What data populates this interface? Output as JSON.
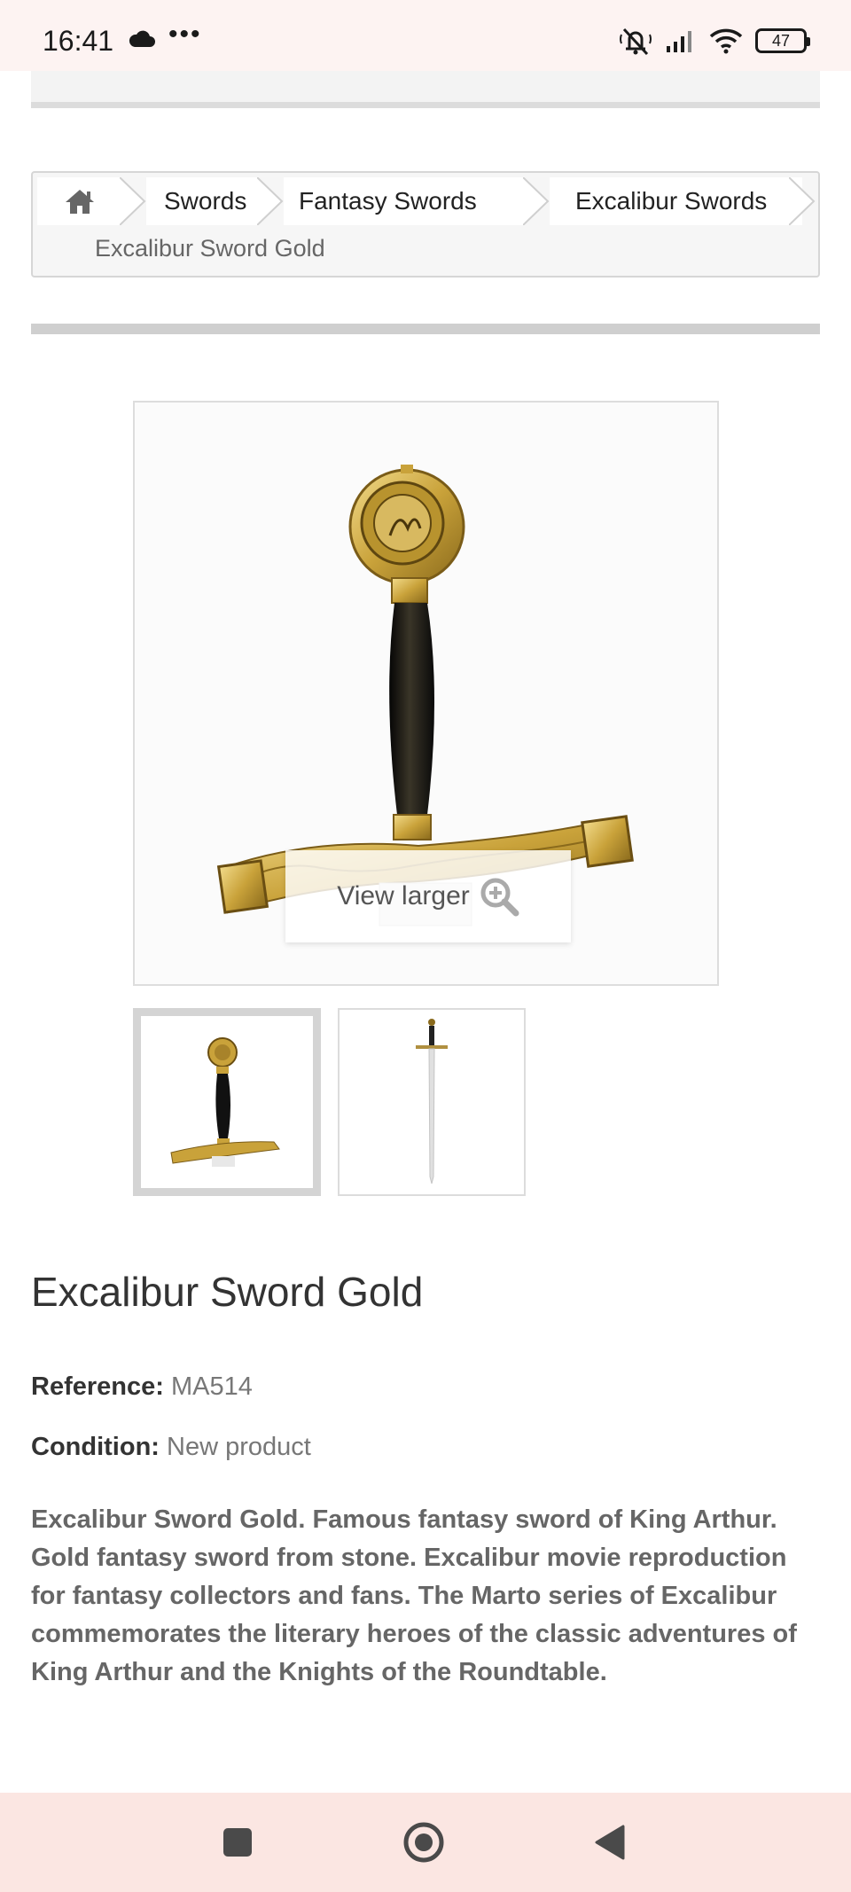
{
  "status_bar": {
    "time": "16:41",
    "dots": "•••",
    "battery": "47",
    "icons": [
      "cloud-icon",
      "mute-icon",
      "signal-icon",
      "wifi-icon",
      "battery-icon"
    ]
  },
  "breadcrumb": {
    "home_icon": "home-icon",
    "items": [
      "Swords",
      "Fantasy Swords",
      "Excalibur Swords"
    ],
    "current": "Excalibur Sword Gold"
  },
  "gallery": {
    "view_larger": "View larger",
    "zoom_icon": "zoom-in-icon",
    "thumbnails": [
      "sword-hilt-thumbnail",
      "full-sword-thumbnail"
    ],
    "selected_index": 0
  },
  "product": {
    "title": "Excalibur Sword Gold",
    "reference_label": "Reference:",
    "reference_value": "MA514",
    "condition_label": "Condition:",
    "condition_value": "New product",
    "description": "Excalibur Sword Gold. Famous fantasy sword of King Arthur. Gold fantasy sword from stone. Excalibur movie reproduction for fantasy collectors and fans. The Marto series of Excalibur commemorates the literary heroes of the classic adventures of King Arthur and the Knights of the Roundtable."
  },
  "nav_bar": {
    "buttons": [
      "recents-button",
      "home-button",
      "back-button"
    ]
  },
  "colors": {
    "status_bg": "#fdf3f2",
    "nav_bg": "#fbe6e2",
    "gold": "#c9a23a",
    "grip": "#1c1a14"
  }
}
